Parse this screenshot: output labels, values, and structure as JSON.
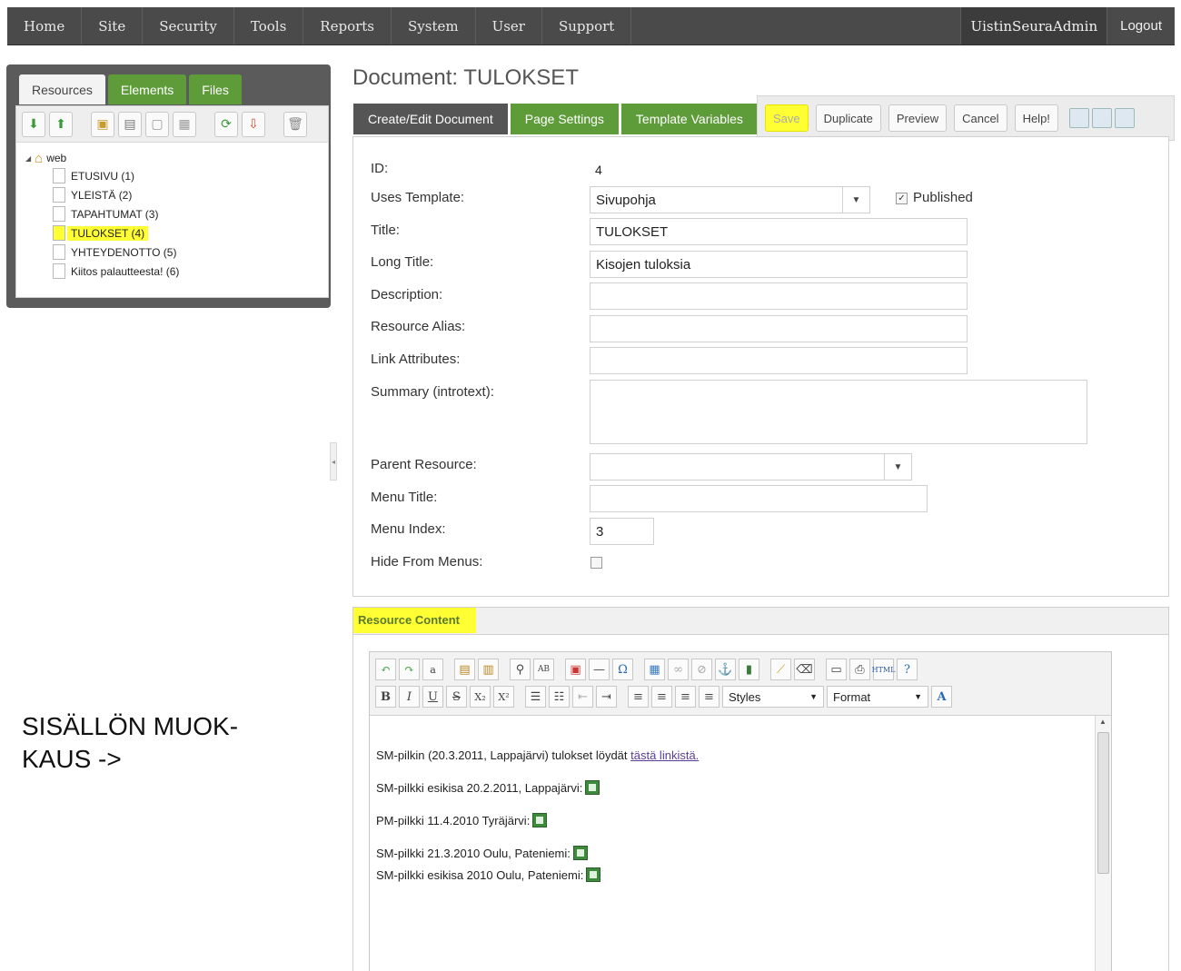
{
  "topnav": {
    "items": [
      "Home",
      "Site",
      "Security",
      "Tools",
      "Reports",
      "System",
      "User",
      "Support"
    ],
    "user": "UistinSeuraAdmin",
    "logout": "Logout"
  },
  "left_panel": {
    "tabs": [
      "Resources",
      "Elements",
      "Files"
    ],
    "tree": {
      "root": "web",
      "nodes": [
        "ETUSIVU (1)",
        "YLEISTÄ (2)",
        "TAPAHTUMAT (3)",
        "TULOKSET (4)",
        "YHTEYDENOTTO (5)",
        "Kiitos palautteesta! (6)"
      ]
    }
  },
  "document": {
    "title": "Document: TULOKSET",
    "tabs": [
      "Create/Edit Document",
      "Page Settings",
      "Template Variables"
    ],
    "actions": {
      "save": "Save",
      "duplicate": "Duplicate",
      "preview": "Preview",
      "cancel": "Cancel",
      "help": "Help!"
    }
  },
  "form": {
    "id_label": "ID:",
    "id_value": "4",
    "template_label": "Uses Template:",
    "template_value": "Sivupohja",
    "published_label": "Published",
    "title_label": "Title:",
    "title_value": "TULOKSET",
    "longtitle_label": "Long Title:",
    "longtitle_value": "Kisojen tuloksia",
    "description_label": "Description:",
    "alias_label": "Resource Alias:",
    "link_attr_label": "Link Attributes:",
    "summary_label": "Summary (introtext):",
    "parent_label": "Parent Resource:",
    "menu_title_label": "Menu Title:",
    "menu_index_label": "Menu Index:",
    "menu_index_value": "3",
    "hide_menus_label": "Hide From Menus:"
  },
  "content": {
    "header": "Resource Content",
    "styles": "Styles",
    "format": "Format",
    "lines": {
      "line1_prefix": "SM-pilkin (20.3.2011, Lappajärvi) tulokset löydät ",
      "line1_link": "tästä linkistä.",
      "line2": "SM-pilkki esikisa 20.2.2011, Lappajärvi:",
      "line3": "PM-pilkki 11.4.2010 Tyräjärvi:",
      "line4": "SM-pilkki 21.3.2010 Oulu, Pateniemi:",
      "line5": "SM-pilkki esikisa 2010 Oulu, Pateniemi:"
    }
  },
  "annotation": {
    "line1": "SISÄLLÖN MUOK-",
    "line2": "KAUS ->"
  }
}
